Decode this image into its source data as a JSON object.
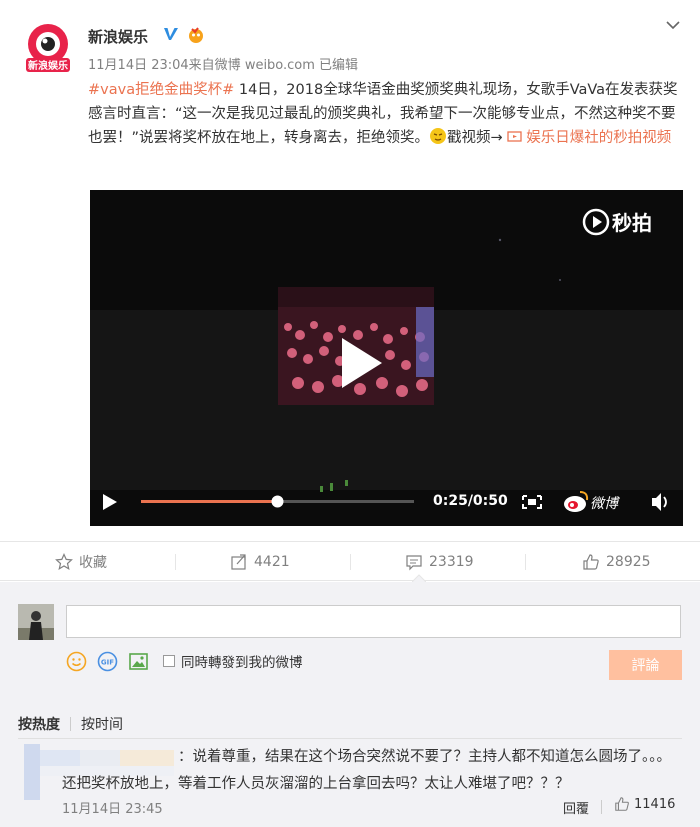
{
  "post": {
    "account_name": "新浪娱乐",
    "meta": "11月14日 23:04来自微博 weibo.com  已编辑",
    "hashtag": "#vava拒绝金曲奖杯#",
    "text_main": " 14日，2018全球华语金曲奖颁奖典礼现场，女歌手VaVa在发表获奖感言时直言：“这一次是我见过最乱的颁奖典礼，我希望下一次能够专业点，不然这种奖不要也罢！”说罢将奖杯放在地上，转身离去，拒绝领奖。",
    "text_tail": "戳视频→ ",
    "video_link": "娱乐日爆社的秒拍视频"
  },
  "video": {
    "watermark": "秒拍",
    "time": "0:25/0:50",
    "weibo_brand": "微博",
    "progress": 0.5
  },
  "actions": {
    "favorite": "收藏",
    "repost": "4421",
    "comments": "23319",
    "likes": "28925"
  },
  "composer": {
    "repost_label": "同時轉發到我的微博",
    "submit": "評論"
  },
  "sort": {
    "hot": "按热度",
    "time": "按时间"
  },
  "comment": {
    "text": "：说着尊重，结果在这个场合突然说不要了？主持人都不知道怎么圆场了。。。还把奖杯放地上，等着工作人员灰溜溜的上台拿回去吗？太让人难堪了吧？？？",
    "time": "11月14日 23:45",
    "reply": "回覆",
    "likes": "11416"
  },
  "colors": {
    "accent": "#eb7350",
    "submit_disabled": "#ffc09f",
    "video_bg": "#0b0b0b"
  }
}
